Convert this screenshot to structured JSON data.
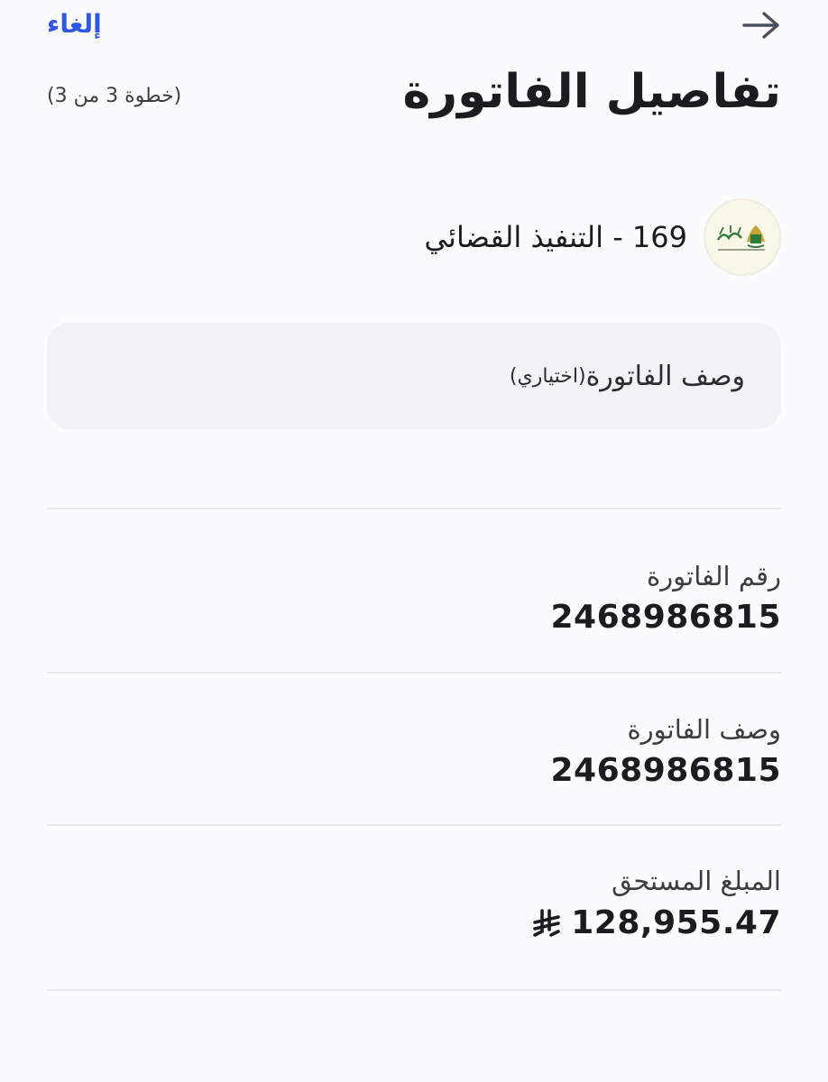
{
  "header": {
    "cancel_label": "إلغاء",
    "back_icon": "arrow-right-icon",
    "title": "تفاصيل الفاتورة",
    "step": "(خطوة 3 من 3)"
  },
  "biller": {
    "logo_icon": "ministry-of-justice-logo",
    "name": "169 - التنفيذ القضائي"
  },
  "description_input": {
    "label": "وصف الفاتورة",
    "optional": "(اختياري)",
    "value": ""
  },
  "details": [
    {
      "label": "رقم الفاتورة",
      "value": "2468986815"
    },
    {
      "label": "وصف الفاتورة",
      "value": "2468986815"
    },
    {
      "label": "المبلغ المستحق",
      "value": "128,955.47",
      "currency_icon": "saudi-riyal-icon"
    }
  ],
  "colors": {
    "accent": "#2f56e6",
    "text": "#1c1c1e",
    "muted": "#3c3c43",
    "field_bg": "#f1f2f6",
    "divider": "#e6e7ec"
  }
}
